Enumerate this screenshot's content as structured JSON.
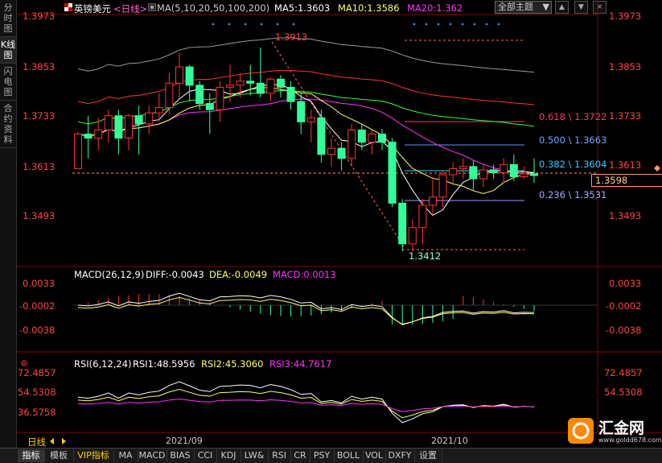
{
  "sidebar": {
    "tabs": [
      {
        "label": "分时图",
        "active": false
      },
      {
        "label": "K线图",
        "active": true
      },
      {
        "label": "闪电图",
        "active": false
      },
      {
        "label": "合约资料",
        "active": false
      }
    ]
  },
  "header": {
    "symbol": "英镑美元",
    "period": "<日线>",
    "ma_params": "MA(5,10,20,50,100,200)",
    "ma5": "MA5:1.3603",
    "ma10": "MA10:1.3586",
    "ma20": "MA20:1.362",
    "theme_dropdown": "全部主题",
    "window_buttons": [
      "▲",
      "▼",
      "×"
    ]
  },
  "price_axis": {
    "labels": [
      "1.3973",
      "1.3853",
      "1.3733",
      "1.3613",
      "1.3493"
    ],
    "current_price": "1.3598"
  },
  "chart_annotations": {
    "high": "1.3913",
    "low": "1.3412",
    "fib": [
      {
        "label": "0.618 \\ 1.3722",
        "color": "#ff3366"
      },
      {
        "label": "0.500 \\ 1.3663",
        "color": "#66aaff"
      },
      {
        "label": "0.382 \\ 1.3604",
        "color": "#33ccff"
      },
      {
        "label": "0.236 \\ 1.3531",
        "color": "#aaaaff"
      }
    ]
  },
  "macd": {
    "title": "MACD(26,12,9)",
    "diff": "DIFF:-0.0043",
    "dea": "DEA:-0.0049",
    "macd": "MACD:0.0013",
    "axis_labels": [
      "0.0033",
      "-0.0002",
      "-0.0038"
    ]
  },
  "rsi": {
    "title": "RSI(6,12,24)",
    "rsi1": "RSI1:48.5956",
    "rsi2": "RSI2:45.3060",
    "rsi3": "RSI3:44.7617",
    "axis_labels": [
      "72.4857",
      "54.5308",
      "36.5758"
    ]
  },
  "date_axis": [
    "2021/09",
    "2021/10"
  ],
  "period_label": "日线",
  "bottom_tabs": [
    "指标",
    "模板",
    "VIP指标",
    "MA",
    "MACD",
    "BIAS",
    "CCI",
    "KDJ",
    "LW&",
    "RSI",
    "CR",
    "PSY",
    "BOLL",
    "VOL",
    "DXFY",
    "设置"
  ],
  "logo": {
    "name": "汇金网",
    "url_text": "www.goldd678.com"
  },
  "colors": {
    "up": "#ff3333",
    "down": "#33ff99",
    "ma5": "#ffffff",
    "ma10": "#ffff66",
    "ma20": "#ff33ff",
    "ma50": "#33ff33",
    "ma100": "#ff3333",
    "ma200": "#aaaaaa",
    "axis_text": "#ff4444"
  },
  "chart_data": {
    "type": "candlestick",
    "candles": [
      {
        "o": 1.3615,
        "h": 1.3705,
        "l": 1.3615,
        "c": 1.37
      },
      {
        "o": 1.37,
        "h": 1.3745,
        "l": 1.364,
        "c": 1.369
      },
      {
        "o": 1.369,
        "h": 1.374,
        "l": 1.366,
        "c": 1.371
      },
      {
        "o": 1.371,
        "h": 1.376,
        "l": 1.368,
        "c": 1.3745
      },
      {
        "o": 1.3745,
        "h": 1.376,
        "l": 1.365,
        "c": 1.369
      },
      {
        "o": 1.369,
        "h": 1.375,
        "l": 1.366,
        "c": 1.3745
      },
      {
        "o": 1.3745,
        "h": 1.377,
        "l": 1.365,
        "c": 1.3725
      },
      {
        "o": 1.3725,
        "h": 1.377,
        "l": 1.37,
        "c": 1.3752
      },
      {
        "o": 1.3752,
        "h": 1.38,
        "l": 1.373,
        "c": 1.3765
      },
      {
        "o": 1.3765,
        "h": 1.385,
        "l": 1.375,
        "c": 1.3825
      },
      {
        "o": 1.3825,
        "h": 1.39,
        "l": 1.379,
        "c": 1.3865
      },
      {
        "o": 1.3865,
        "h": 1.387,
        "l": 1.378,
        "c": 1.382
      },
      {
        "o": 1.382,
        "h": 1.383,
        "l": 1.376,
        "c": 1.3775
      },
      {
        "o": 1.3775,
        "h": 1.38,
        "l": 1.37,
        "c": 1.376
      },
      {
        "o": 1.376,
        "h": 1.383,
        "l": 1.373,
        "c": 1.3815
      },
      {
        "o": 1.3815,
        "h": 1.387,
        "l": 1.378,
        "c": 1.382
      },
      {
        "o": 1.382,
        "h": 1.385,
        "l": 1.379,
        "c": 1.383
      },
      {
        "o": 1.383,
        "h": 1.387,
        "l": 1.3795,
        "c": 1.3825
      },
      {
        "o": 1.3825,
        "h": 1.3913,
        "l": 1.379,
        "c": 1.38
      },
      {
        "o": 1.38,
        "h": 1.384,
        "l": 1.378,
        "c": 1.3835
      },
      {
        "o": 1.3835,
        "h": 1.3845,
        "l": 1.379,
        "c": 1.3815
      },
      {
        "o": 1.3815,
        "h": 1.383,
        "l": 1.376,
        "c": 1.378
      },
      {
        "o": 1.378,
        "h": 1.38,
        "l": 1.37,
        "c": 1.373
      },
      {
        "o": 1.373,
        "h": 1.376,
        "l": 1.368,
        "c": 1.374
      },
      {
        "o": 1.374,
        "h": 1.376,
        "l": 1.363,
        "c": 1.365
      },
      {
        "o": 1.365,
        "h": 1.369,
        "l": 1.362,
        "c": 1.3665
      },
      {
        "o": 1.3665,
        "h": 1.368,
        "l": 1.361,
        "c": 1.364
      },
      {
        "o": 1.364,
        "h": 1.3725,
        "l": 1.362,
        "c": 1.371
      },
      {
        "o": 1.371,
        "h": 1.3725,
        "l": 1.366,
        "c": 1.368
      },
      {
        "o": 1.368,
        "h": 1.371,
        "l": 1.365,
        "c": 1.37
      },
      {
        "o": 1.37,
        "h": 1.3712,
        "l": 1.366,
        "c": 1.368
      },
      {
        "o": 1.368,
        "h": 1.369,
        "l": 1.352,
        "c": 1.353
      },
      {
        "o": 1.353,
        "h": 1.354,
        "l": 1.3412,
        "c": 1.343
      },
      {
        "o": 1.343,
        "h": 1.349,
        "l": 1.3412,
        "c": 1.347
      },
      {
        "o": 1.347,
        "h": 1.354,
        "l": 1.343,
        "c": 1.3525
      },
      {
        "o": 1.3525,
        "h": 1.3595,
        "l": 1.35,
        "c": 1.3545
      },
      {
        "o": 1.3545,
        "h": 1.361,
        "l": 1.352,
        "c": 1.36
      },
      {
        "o": 1.36,
        "h": 1.363,
        "l": 1.358,
        "c": 1.3615
      },
      {
        "o": 1.3615,
        "h": 1.364,
        "l": 1.359,
        "c": 1.362
      },
      {
        "o": 1.362,
        "h": 1.3635,
        "l": 1.356,
        "c": 1.359
      },
      {
        "o": 1.359,
        "h": 1.3625,
        "l": 1.357,
        "c": 1.3612
      },
      {
        "o": 1.3612,
        "h": 1.3625,
        "l": 1.359,
        "c": 1.3605
      },
      {
        "o": 1.3605,
        "h": 1.364,
        "l": 1.358,
        "c": 1.3625
      },
      {
        "o": 1.3625,
        "h": 1.365,
        "l": 1.3585,
        "c": 1.3595
      },
      {
        "o": 1.3595,
        "h": 1.362,
        "l": 1.359,
        "c": 1.3602
      },
      {
        "o": 1.3602,
        "h": 1.364,
        "l": 1.358,
        "c": 1.3598
      }
    ],
    "ylim": [
      1.34,
      1.399
    ]
  }
}
